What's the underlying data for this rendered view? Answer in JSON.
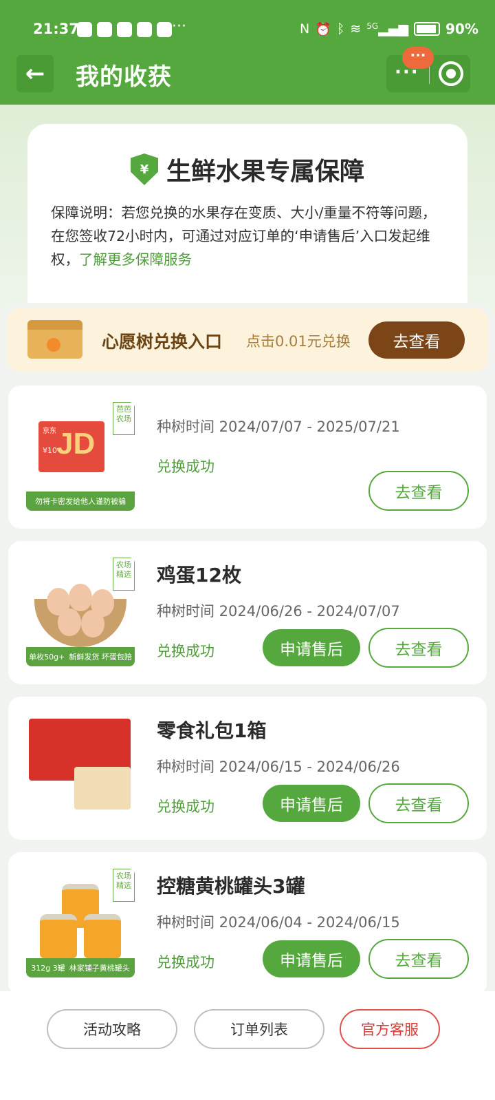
{
  "status_bar": {
    "time": "21:37",
    "more": "···",
    "network": "5G",
    "battery": "90%",
    "icons": [
      "nfc-icon",
      "alarm-icon",
      "bluetooth-icon",
      "wifi-icon",
      "signal-icon",
      "battery-icon"
    ]
  },
  "nav": {
    "back_icon": "←",
    "title": "我的收获",
    "more_dots": "···",
    "badge": "···"
  },
  "guarantee": {
    "shield_symbol": "¥",
    "title": "生鲜水果专属保障",
    "desc": "保障说明：若您兑换的水果存在变质、大小/重量不符等问题，在您签收72小时内，可通过对应订单的‘申请售后’入口发起维权，",
    "link": "了解更多保障服务"
  },
  "wish": {
    "title": "心愿树兑换入口",
    "subtitle": "点击0.01元兑换",
    "button": "去查看"
  },
  "orders": [
    {
      "title": "",
      "date": "种树时间 2024/07/07 - 2025/07/21",
      "status": "兑换成功",
      "view_label": "去查看",
      "tag": "芭芭农场",
      "img_text": {
        "brand": "京东",
        "logo": "JD",
        "price": "¥10",
        "footer": "勿将卡密发给他人谨防被骗"
      }
    },
    {
      "title": "鸡蛋12枚",
      "date": "种树时间 2024/06/26 - 2024/07/07",
      "status": "兑换成功",
      "after_label": "申请售后",
      "view_label": "去查看",
      "tag": "农场精选",
      "img_text": {
        "footer": "新鲜发货 坏蛋包赔",
        "spec": "单枚50g+"
      }
    },
    {
      "title": "零食礼包1箱",
      "date": "种树时间 2024/06/15 - 2024/06/26",
      "status": "兑换成功",
      "after_label": "申请售后",
      "view_label": "去查看"
    },
    {
      "title": "控糖黄桃罐头3罐",
      "date": "种树时间 2024/06/04 - 2024/06/15",
      "status": "兑换成功",
      "after_label": "申请售后",
      "view_label": "去查看",
      "tag": "农场精选",
      "img_text": {
        "footer": "林家铺子黄桃罐头",
        "spec": "312g 3罐"
      }
    }
  ],
  "bottom": {
    "strategy": "活动攻略",
    "orders": "订单列表",
    "service": "官方客服"
  },
  "colors": {
    "brand_green": "#55a83e",
    "wish_brown": "#7c4517",
    "service_red": "#d63b35"
  }
}
